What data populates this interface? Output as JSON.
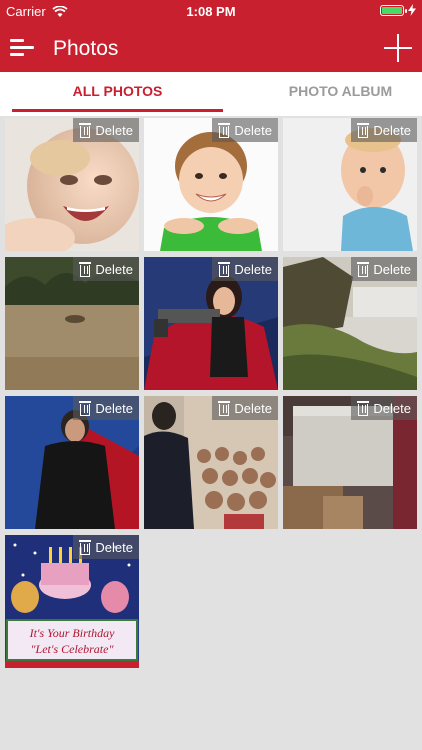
{
  "status": {
    "carrier": "Carrier",
    "time": "1:08 PM"
  },
  "navbar": {
    "title": "Photos",
    "menu_icon": "menu-icon",
    "add_icon": "plus-icon"
  },
  "tabs": [
    {
      "label": "ALL PHOTOS",
      "active": true
    },
    {
      "label": "PHOTO ALBUM",
      "active": false
    }
  ],
  "photos": [
    {
      "name": "laughing baby",
      "delete": "Delete"
    },
    {
      "name": "smiling boy",
      "delete": "Delete"
    },
    {
      "name": "baby in blue shirt",
      "delete": "Delete"
    },
    {
      "name": "forest ground",
      "delete": "Delete"
    },
    {
      "name": "woman with gun",
      "delete": "Delete"
    },
    {
      "name": "waterfall landscape",
      "delete": "Delete"
    },
    {
      "name": "man in black",
      "delete": "Delete"
    },
    {
      "name": "presenter with audience",
      "delete": "Delete"
    },
    {
      "name": "boxes in room",
      "delete": "Delete"
    },
    {
      "name": "birthday card",
      "delete": "Delete"
    }
  ],
  "colors": {
    "brand": "#c8202e",
    "inactive_tab": "#9b9b9b",
    "background": "#e1e1e1"
  }
}
